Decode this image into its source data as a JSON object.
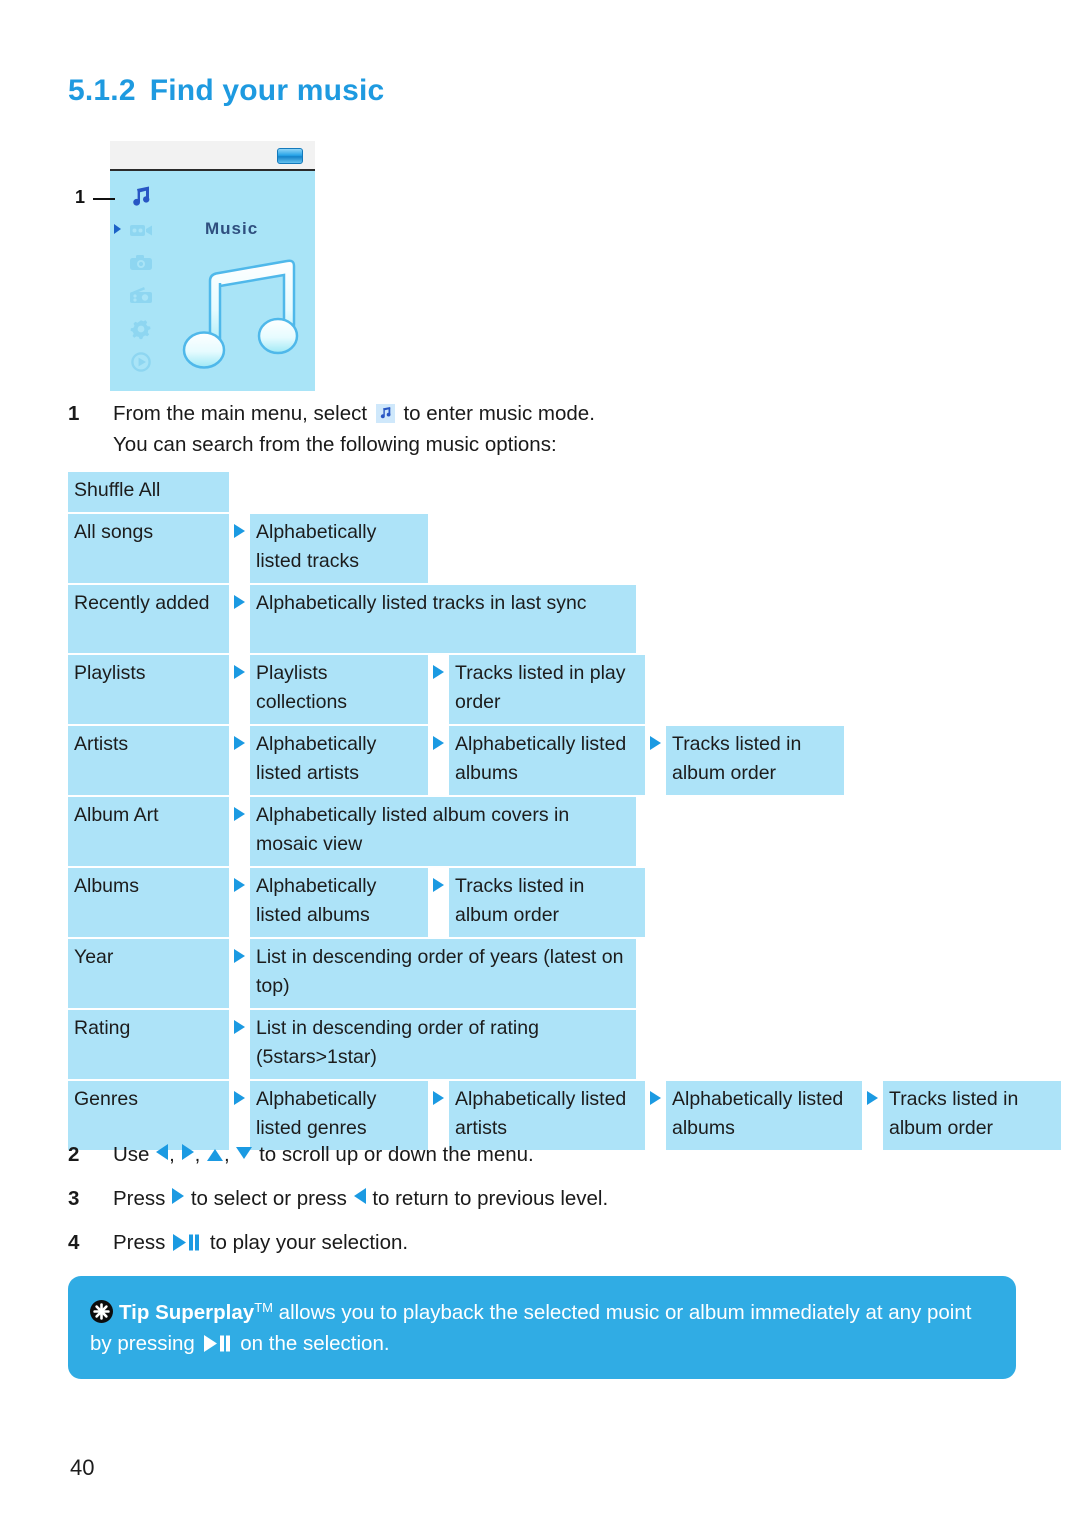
{
  "heading": {
    "number": "5.1.2",
    "title": "Find your music"
  },
  "device": {
    "screen_title": "Music",
    "callout_label": "1",
    "rail_icons": [
      "music-note-icon",
      "video-camera-icon",
      "camera-icon",
      "radio-icon",
      "settings-gear-icon",
      "play-circle-icon"
    ],
    "status_icon": "battery-icon"
  },
  "step1": {
    "number": "1",
    "text_before": "From the main menu, select",
    "text_after": "to enter music mode.",
    "line2": "You can search from the following music options:"
  },
  "options_table": [
    {
      "level1": "Shuffle All",
      "cells": []
    },
    {
      "level1": "All songs",
      "cells": [
        "Alphabetically listed tracks"
      ]
    },
    {
      "level1": "Recently added",
      "cells": [
        "Alphabetically listed tracks in last sync"
      ]
    },
    {
      "level1": "Playlists",
      "cells": [
        "Playlists collections",
        "Tracks listed in play order"
      ]
    },
    {
      "level1": "Artists",
      "cells": [
        "Alphabetically listed artists",
        "Alphabetically listed albums",
        "Tracks listed in album order"
      ]
    },
    {
      "level1": "Album Art",
      "cells": [
        "Alphabetically listed album covers in mosaic view"
      ]
    },
    {
      "level1": "Albums",
      "cells": [
        "Alphabetically listed albums",
        "Tracks listed in album order"
      ]
    },
    {
      "level1": "Year",
      "cells": [
        "List in descending order of years (latest on top)"
      ]
    },
    {
      "level1": "Rating",
      "cells": [
        "List in descending order of rating (5stars>1star)"
      ]
    },
    {
      "level1": "Genres",
      "cells": [
        "Alphabetically listed genres",
        "Alphabetically listed artists",
        "Alphabetically listed albums",
        "Tracks listed in album order"
      ]
    }
  ],
  "steps": {
    "s2_num": "2",
    "s2_a": "Use",
    "s2_b": ",",
    "s2_c": ",",
    "s2_d": ",",
    "s2_e": "to scroll up or down the menu.",
    "s3_num": "3",
    "s3_a": "Press",
    "s3_b": "to select or press",
    "s3_c": "to return to previous level.",
    "s4_num": "4",
    "s4_a": "Press",
    "s4_b": "to play your selection."
  },
  "tip": {
    "icon": "asterisk-icon",
    "label": "Tip Superplay",
    "tm": "TM",
    "text_a": "allows you to playback the selected music or album immediately at any point by pressing",
    "text_b": "on the selection."
  },
  "page_number": "40",
  "colors": {
    "heading_blue": "#1e9ae0",
    "cell_blue": "#ade3f8",
    "arrow_blue": "#1b9ae2",
    "tip_blue": "#30ace4",
    "device_screen": "#a9e4f7"
  }
}
